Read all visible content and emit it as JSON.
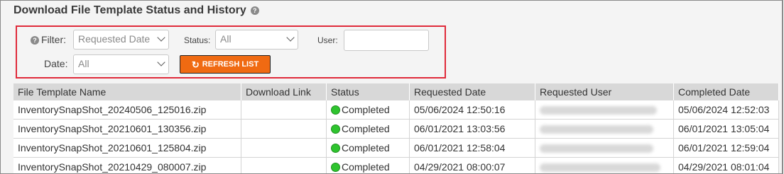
{
  "title": "Download File Template Status and History",
  "filters": {
    "filter_label": "Filter:",
    "filter_value": "Requested Date",
    "status_label": "Status:",
    "status_value": "All",
    "user_label": "User:",
    "user_value": "",
    "date_label": "Date:",
    "date_value": "All",
    "refresh_label": "REFRESH LIST"
  },
  "table": {
    "columns": [
      "File Template Name",
      "Download Link",
      "Status",
      "Requested Date",
      "Requested User",
      "Completed Date"
    ],
    "rows": [
      {
        "name": "InventorySnapShot_20240506_125016.zip",
        "link": "",
        "status": "Completed",
        "requested": "05/06/2024 12:50:16",
        "user": "",
        "completed": "05/06/2024 12:52:03"
      },
      {
        "name": "InventorySnapShot_20210601_130356.zip",
        "link": "",
        "status": "Completed",
        "requested": "06/01/2021 13:03:56",
        "user": "",
        "completed": "06/01/2021 13:05:04"
      },
      {
        "name": "InventorySnapShot_20210601_125804.zip",
        "link": "",
        "status": "Completed",
        "requested": "06/01/2021 12:58:04",
        "user": "",
        "completed": "06/01/2021 12:59:04"
      },
      {
        "name": "InventorySnapShot_20210429_080007.zip",
        "link": "",
        "status": "Completed",
        "requested": "04/29/2021 08:00:07",
        "user": "",
        "completed": "04/29/2021 08:01:04"
      }
    ]
  },
  "colors": {
    "accent": "#f06a12",
    "highlight_border": "#e02a3a",
    "status_completed": "#2e8b2e"
  }
}
